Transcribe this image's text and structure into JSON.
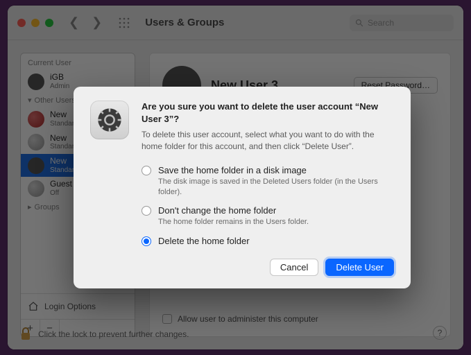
{
  "window": {
    "title": "Users & Groups",
    "search_placeholder": "Search"
  },
  "sidebar": {
    "current_label": "Current User",
    "other_label": "Other Users",
    "groups_label": "Groups",
    "login_options": "Login Options",
    "current_user": {
      "name": "iGB",
      "role": "Admin"
    },
    "users": [
      {
        "name": "New",
        "role": "Standard"
      },
      {
        "name": "New",
        "role": "Standard"
      },
      {
        "name": "New",
        "role": "Standard"
      },
      {
        "name": "Guest",
        "role": "Off"
      }
    ],
    "plus": "+",
    "minus": "−"
  },
  "main": {
    "user_name": "New User 3",
    "reset_password": "Reset Password…",
    "admin_check_label": "Allow user to administer this computer"
  },
  "lock": {
    "message": "Click the lock to prevent further changes."
  },
  "dialog": {
    "title": "Are you sure you want to delete the user account “New User 3”?",
    "description": "To delete this user account, select what you want to do with the home folder for this account, and then click “Delete User”.",
    "options": [
      {
        "label": "Save the home folder in a disk image",
        "sub": "The disk image is saved in the Deleted Users folder (in the Users folder).",
        "checked": false
      },
      {
        "label": "Don't change the home folder",
        "sub": "The home folder remains in the Users folder.",
        "checked": false
      },
      {
        "label": "Delete the home folder",
        "sub": "",
        "checked": true
      }
    ],
    "cancel": "Cancel",
    "confirm": "Delete User"
  },
  "help_glyph": "?"
}
